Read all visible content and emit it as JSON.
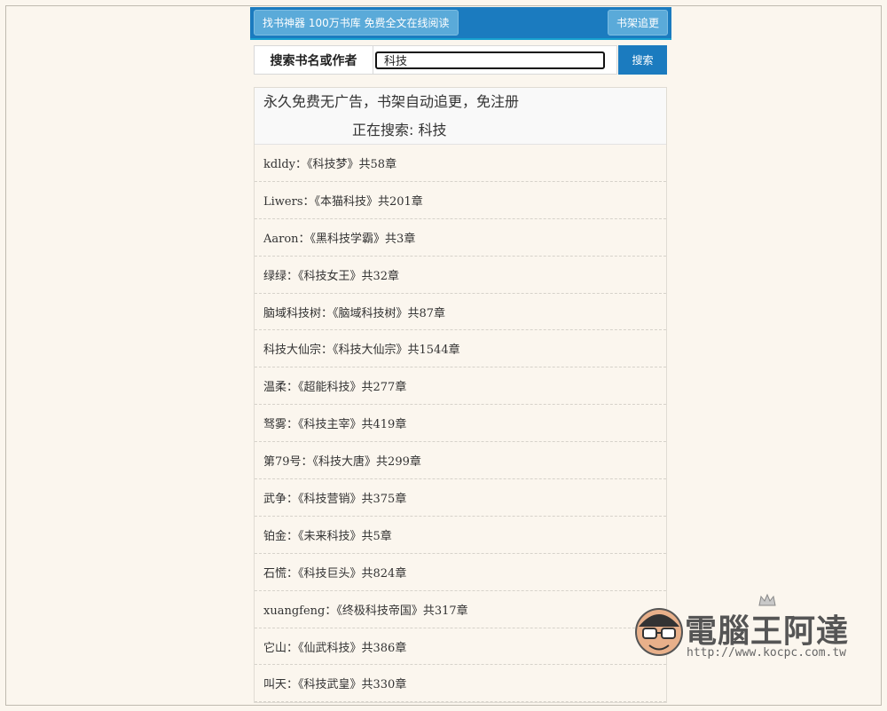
{
  "topbar": {
    "left_button": "找书神器 100万书库 免费全文在线阅读",
    "right_button": "书架追更"
  },
  "search": {
    "label": "搜索书名或作者",
    "value": "科技",
    "button": "搜索"
  },
  "panel": {
    "slogan": "永久免费无广告，书架自动追更，免注册",
    "searching": "正在搜索: 科技"
  },
  "results": [
    "kdldy：《科技梦》共58章",
    "Liwers：《本猫科技》共201章",
    "Aaron：《黑科技学霸》共3章",
    "绿绿：《科技女王》共32章",
    "脑域科技树：《脑域科技树》共87章",
    "科技大仙宗：《科技大仙宗》共1544章",
    "温柔：《超能科技》共277章",
    "驽雾：《科技主宰》共419章",
    "第79号：《科技大唐》共299章",
    "武争：《科技营销》共375章",
    "铂金：《未来科技》共5章",
    "石慌：《科技巨头》共824章",
    "xuangfeng：《终极科技帝国》共317章",
    "它山：《仙武科技》共386章",
    "叫天：《科技武皇》共330章"
  ],
  "watermark": {
    "brand": "電腦王阿達",
    "url": "http://www.kocpc.com.tw"
  }
}
